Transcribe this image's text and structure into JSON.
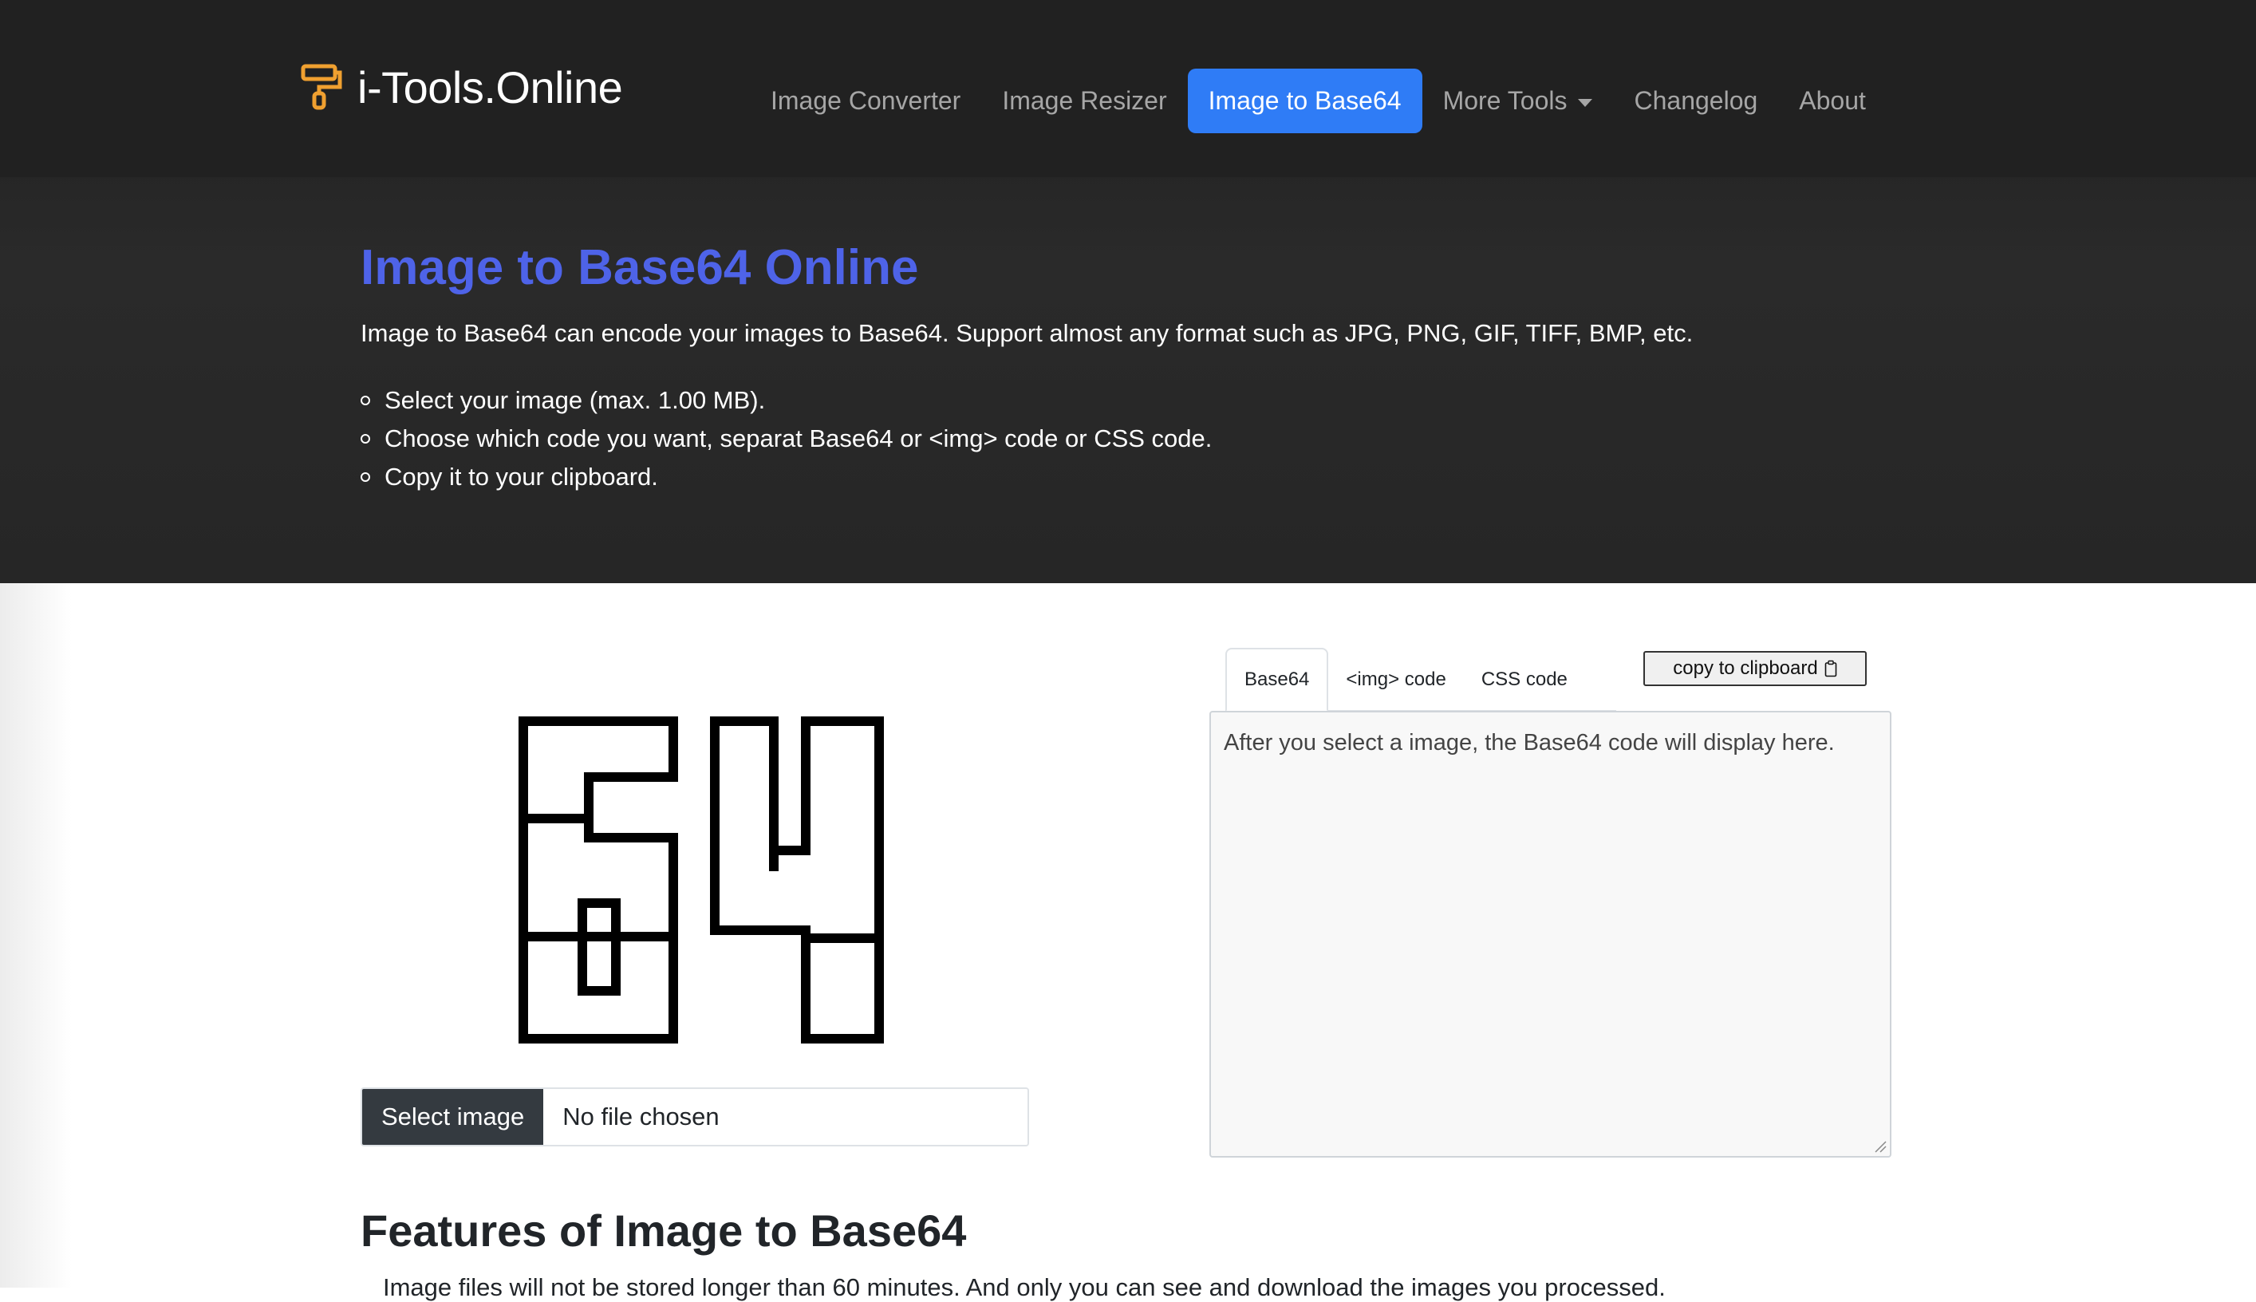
{
  "brand": {
    "name": "i-Tools.Online",
    "icon": "paint-roller-icon",
    "icon_color": "#f0a030"
  },
  "nav": {
    "items": [
      {
        "label": "Image Converter",
        "active": false
      },
      {
        "label": "Image Resizer",
        "active": false
      },
      {
        "label": "Image to Base64",
        "active": true
      },
      {
        "label": "More Tools",
        "active": false,
        "dropdown": true
      },
      {
        "label": "Changelog",
        "active": false
      },
      {
        "label": "About",
        "active": false
      }
    ],
    "active_color": "#2f7cf6"
  },
  "hero": {
    "title": "Image to Base64 Online",
    "title_color": "#4e63e8",
    "description": "Image to Base64 can encode your images to Base64. Support almost any format such as JPG, PNG, GIF, TIFF, BMP, etc.",
    "steps": [
      "Select your image (max. 1.00 MB).",
      "Choose which code you want, separat Base64 or <img> code or CSS code.",
      "Copy it to your clipboard."
    ]
  },
  "uploader": {
    "preview_icon": "base64-logo-icon",
    "button_label": "Select image",
    "file_status": "No file chosen"
  },
  "output": {
    "tabs": [
      {
        "label": "Base64",
        "active": true
      },
      {
        "label": "<img> code",
        "active": false
      },
      {
        "label": "CSS code",
        "active": false
      }
    ],
    "copy_label": "copy to clipboard",
    "placeholder": "After you select a image, the Base64 code will display here."
  },
  "features": {
    "title": "Features of Image to Base64",
    "first_line": "Image files will not be stored longer than 60 minutes. And only you can see and download the images you processed."
  }
}
